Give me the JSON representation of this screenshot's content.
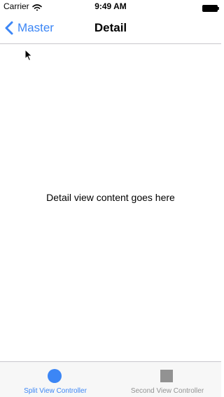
{
  "status_bar": {
    "carrier": "Carrier",
    "time": "9:49 AM",
    "wifi_icon": "wifi-icon",
    "battery_icon": "battery-icon"
  },
  "nav_bar": {
    "back_label": "Master",
    "title": "Detail",
    "accent_color": "#3c86f5"
  },
  "content": {
    "text": "Detail view content goes here"
  },
  "tab_bar": {
    "items": [
      {
        "label": "Split View Controller",
        "icon": "circle-icon",
        "selected": true
      },
      {
        "label": "Second View Controller",
        "icon": "square-icon",
        "selected": false
      }
    ],
    "active_color": "#3c86f5",
    "inactive_color": "#929292"
  }
}
